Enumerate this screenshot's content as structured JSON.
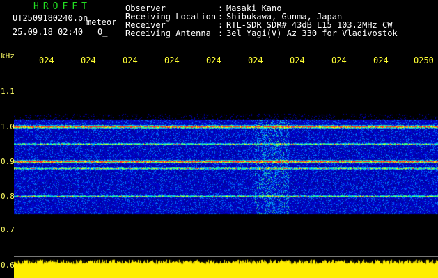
{
  "header": {
    "logo": "HROFFT",
    "filename": "UT2509180240.pn",
    "mode": "meteor",
    "datetime": "25.09.18 02:40",
    "marker": "0_",
    "fields": [
      {
        "label": "Observer",
        "value": "Masaki Kano"
      },
      {
        "label": "Receiving Location",
        "value": "Shibukawa, Gunma, Japan"
      },
      {
        "label": "Receiver",
        "value": "RTL-SDR SDR# 43dB L15 103.2MHz CW"
      },
      {
        "label": "Receiving Antenna",
        "value": "3el Yagi(V) Az 330 for Vladivostok"
      }
    ]
  },
  "axes": {
    "freq_unit": "kHz",
    "freq_ticks": [
      "1.1",
      "1.0",
      "0.9",
      "0.8",
      "0.7",
      "0.6"
    ],
    "time_ticks": [
      "024",
      "024",
      "024",
      "024",
      "024",
      "024",
      "024",
      "024",
      "024",
      "0250"
    ]
  },
  "colors": {
    "background": "#000000",
    "header_text": "#ffffff",
    "logo": "#22dd22",
    "tick_text": "#ffff33",
    "signal_bar": "#ffee00"
  },
  "spectrogram": {
    "freq_range_khz": [
      0.75,
      1.02
    ],
    "strong_bands_khz": [
      1.0,
      0.9
    ],
    "medium_bands_khz": [
      0.95,
      0.88,
      0.8
    ],
    "signal_level": 0.78
  }
}
